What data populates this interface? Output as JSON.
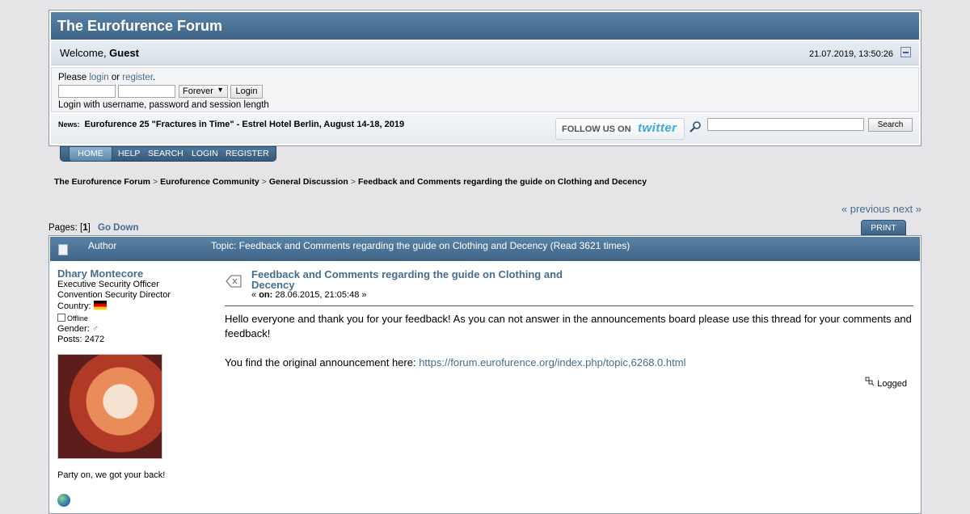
{
  "forum": {
    "title": "The Eurofurence Forum"
  },
  "userbar": {
    "welcome_prefix": "Welcome, ",
    "guest": "Guest",
    "datetime": "21.07.2019, 13:50:26"
  },
  "login": {
    "please": "Please ",
    "login_link": "login",
    "or": " or ",
    "register_link": "register",
    "period": ".",
    "session_option": "Forever",
    "login_button": "Login",
    "help_text": "Login with username, password and session length"
  },
  "news": {
    "label": "News:",
    "text": "Eurofurence 25 \"Fractures in Time\" - Estrel Hotel Berlin, August 14-18, 2019"
  },
  "twitter": {
    "follow": "FOLLOW US ON",
    "brand": "twitter"
  },
  "search": {
    "button": "Search"
  },
  "menu": {
    "items": [
      "HOME",
      "HELP",
      "SEARCH",
      "LOGIN",
      "REGISTER"
    ]
  },
  "breadcrumb": [
    "The Eurofurence Forum",
    "Eurofurence Community",
    "General Discussion",
    "Feedback and Comments regarding the guide on Clothing and Decency"
  ],
  "breadcrumb_sep": ">",
  "pagination": {
    "prev": "« previous",
    "next": "next »",
    "pages_label": "Pages: [",
    "current": "1",
    "close": "]",
    "go_down": "Go Down",
    "print": "PRINT"
  },
  "topic_header": {
    "author": "Author",
    "topic": "Topic: Feedback and Comments regarding the guide on Clothing and Decency  (Read 3621 times)"
  },
  "poster": {
    "name": "Dhary Montecore",
    "title1": "Executive Security Officer",
    "title2": "Convention Security Director",
    "country_label": "Country: ",
    "status": "Offline",
    "gender_label": "Gender: ",
    "posts": "Posts: 2472",
    "signature": "Party on, we got your back!"
  },
  "post": {
    "subject": "Feedback and Comments regarding the guide on Clothing and Decency",
    "on_prefix": "« ",
    "on_label": "on:",
    "date": " 28.06.2015, 21:05:48 »",
    "line1": "Hello everyone and thank you for your feedback! As you can not answer in the announcements board please use this thread for your comments and feedback!",
    "line2": "You find the original announcement here: ",
    "link": "https://forum.eurofurence.org/index.php/topic,6268.0.html",
    "logged": "Logged"
  }
}
